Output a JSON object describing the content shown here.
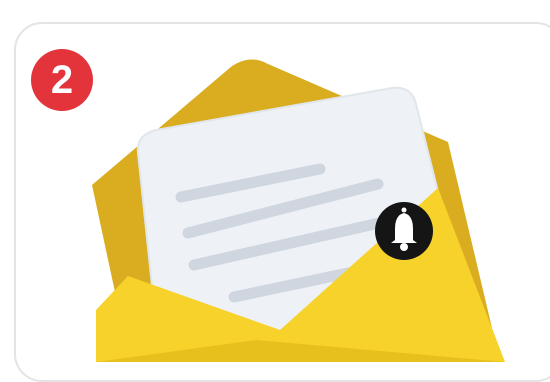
{
  "step_card": {
    "step_number": "2",
    "badge_color": "#e3343c",
    "illustration": "open-envelope-with-letter-and-bell",
    "icons": [
      "envelope-icon",
      "letter-icon",
      "bell-icon"
    ],
    "colors": {
      "envelope_back": "#d9ad1f",
      "envelope_front": "#f7d22a",
      "envelope_front_dark": "#e8c01e",
      "letter": "#eef1f5",
      "letter_lines": "#cfd6df",
      "bell_circle": "#151515",
      "bell": "#ffffff"
    }
  }
}
